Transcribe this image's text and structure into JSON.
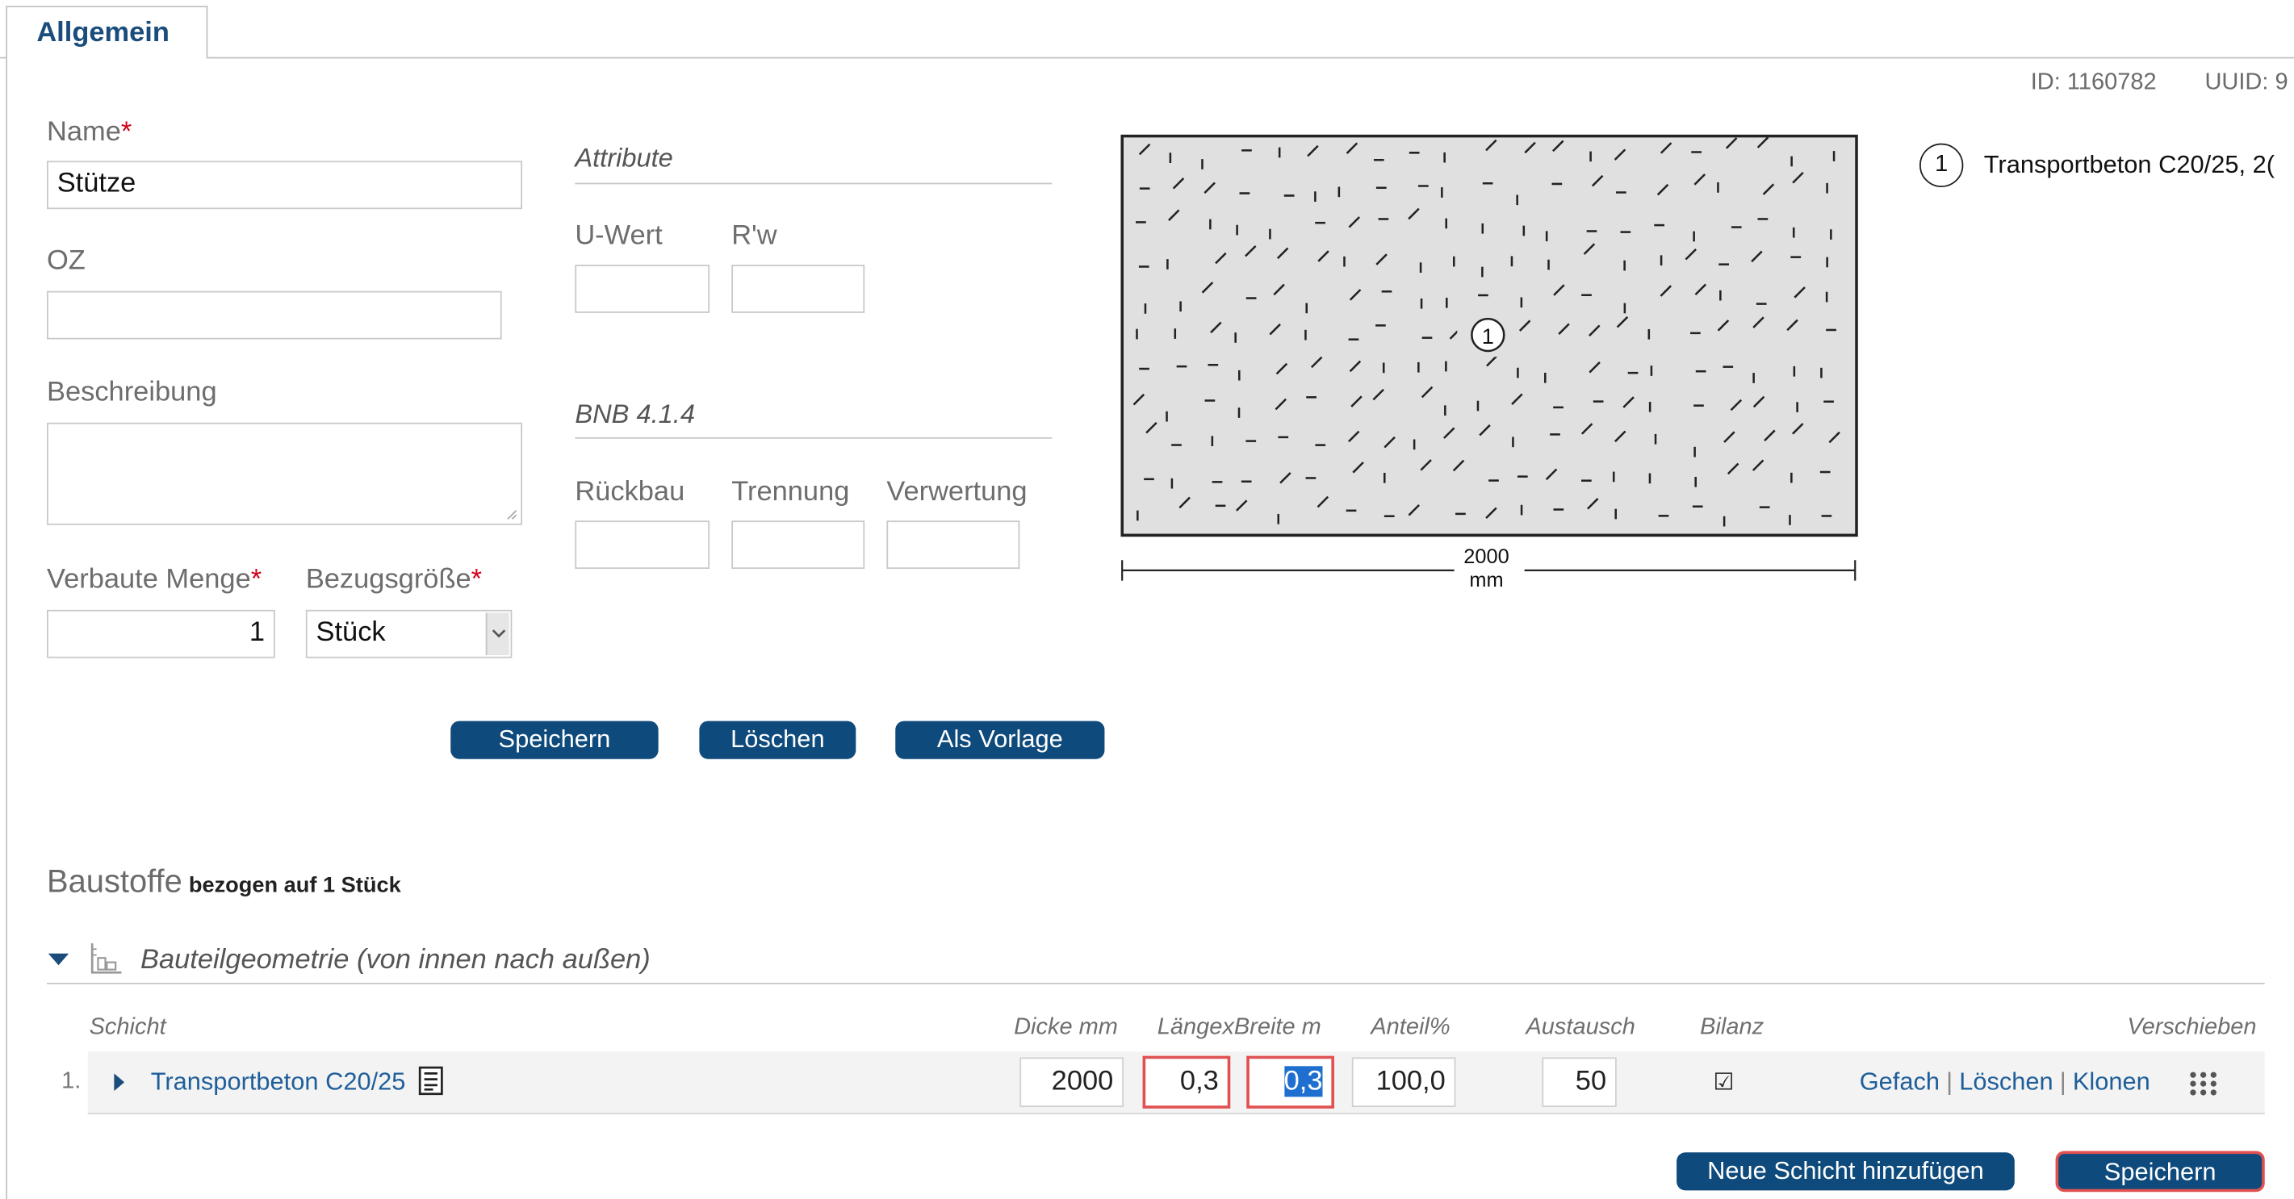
{
  "tab": {
    "label": "Allgemein"
  },
  "meta": {
    "id": "ID: 1160782",
    "uuid": "UUID: 9"
  },
  "form": {
    "name_label": "Name",
    "name_value": "Stütze",
    "oz_label": "OZ",
    "oz_value": "",
    "beschreibung_label": "Beschreibung",
    "verbaute_menge_label": "Verbaute Menge",
    "verbaute_menge_value": "1",
    "bezugsgroesse_label": "Bezugsgröße",
    "bezugsgroesse_value": "Stück",
    "required_mark": "*"
  },
  "attribute": {
    "title": "Attribute",
    "uwert_label": "U-Wert",
    "rw_label": "R'w"
  },
  "bnb": {
    "title": "BNB 4.1.4",
    "rueckbau_label": "Rückbau",
    "trennung_label": "Trennung",
    "verwertung_label": "Verwertung"
  },
  "drawing": {
    "marker": "1",
    "dimension_value": "2000",
    "dimension_unit": "mm",
    "legend_text": "Transportbeton C20/25, 2(",
    "hatch_color": "#e0e0e0"
  },
  "actions": {
    "save": "Speichern",
    "delete": "Löschen",
    "template": "Als Vorlage"
  },
  "baustoffe": {
    "title": "Baustoffe",
    "subtitle": "bezogen auf 1 Stück",
    "group_title": "Bauteilgeometrie (von innen nach außen)"
  },
  "table": {
    "headers": {
      "schicht": "Schicht",
      "dicke": "Dicke mm",
      "laengexbreite": "LängexBreite m",
      "anteil": "Anteil%",
      "austausch": "Austausch",
      "bilanz": "Bilanz",
      "verschieben": "Verschieben"
    },
    "rows": [
      {
        "index": "1.",
        "material": "Transportbeton C20/25",
        "dicke": "2000",
        "laenge": "0,3",
        "breite": "0,3",
        "anteil": "100,0",
        "austausch": "50",
        "bilanz": "☑",
        "link_gefach": "Gefach",
        "link_loeschen": "Löschen",
        "link_klonen": "Klonen",
        "separator": "|"
      }
    ]
  },
  "footer": {
    "add_layer": "Neue Schicht hinzufügen",
    "save": "Speichern"
  },
  "colors": {
    "brand_blue": "#0e4a7b",
    "link_blue": "#1f5e9a",
    "required_red": "#d0021b",
    "error_border": "#e05151"
  }
}
